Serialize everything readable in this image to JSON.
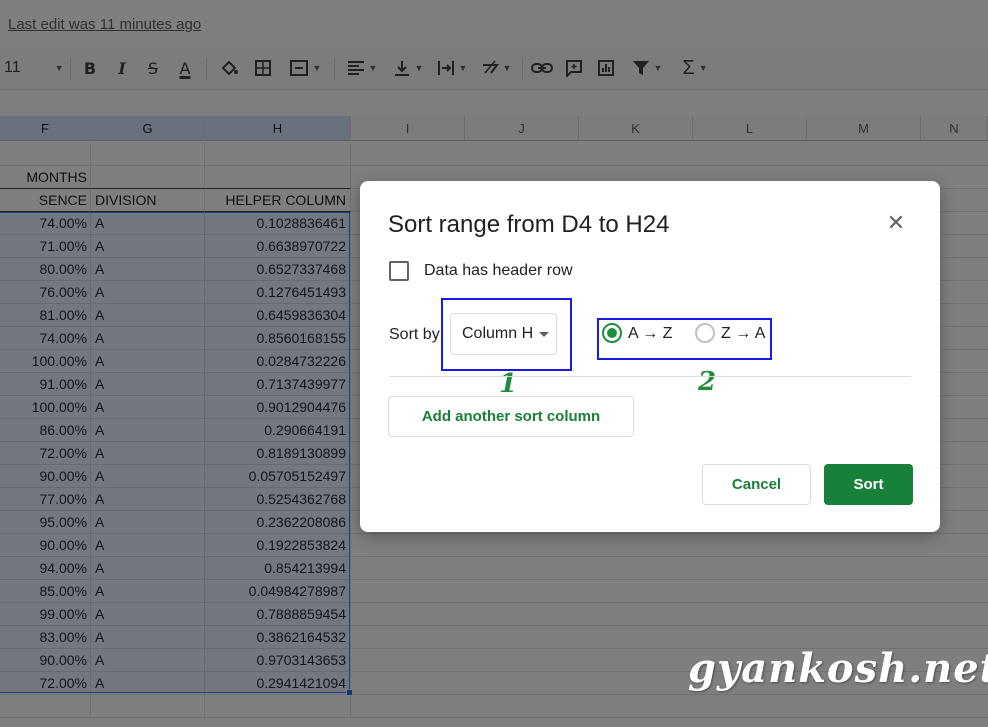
{
  "topbar": {
    "last_edit": "Last edit was 11 minutes ago"
  },
  "toolbar": {
    "font_size": "11",
    "bold": "B",
    "italic": "I",
    "strikethrough": "S",
    "text_color": "A",
    "sigma": "Σ"
  },
  "sheet": {
    "columns": [
      "F",
      "G",
      "H",
      "I",
      "J",
      "K",
      "L",
      "M",
      "N"
    ],
    "header_row1": {
      "f": "MONTHS"
    },
    "header_row2": {
      "f": "SENCE",
      "g": "DIVISION",
      "h": "HELPER COLUMN"
    },
    "rows": [
      {
        "f": "74.00%",
        "g": "A",
        "h": "0.1028836461"
      },
      {
        "f": "71.00%",
        "g": "A",
        "h": "0.6638970722"
      },
      {
        "f": "80.00%",
        "g": "A",
        "h": "0.6527337468"
      },
      {
        "f": "76.00%",
        "g": "A",
        "h": "0.1276451493"
      },
      {
        "f": "81.00%",
        "g": "A",
        "h": "0.6459836304"
      },
      {
        "f": "74.00%",
        "g": "A",
        "h": "0.8560168155"
      },
      {
        "f": "100.00%",
        "g": "A",
        "h": "0.0284732226"
      },
      {
        "f": "91.00%",
        "g": "A",
        "h": "0.7137439977"
      },
      {
        "f": "100.00%",
        "g": "A",
        "h": "0.9012904476"
      },
      {
        "f": "86.00%",
        "g": "A",
        "h": "0.290664191"
      },
      {
        "f": "72.00%",
        "g": "A",
        "h": "0.8189130899"
      },
      {
        "f": "90.00%",
        "g": "A",
        "h": "0.05705152497"
      },
      {
        "f": "77.00%",
        "g": "A",
        "h": "0.5254362768"
      },
      {
        "f": "95.00%",
        "g": "A",
        "h": "0.2362208086"
      },
      {
        "f": "90.00%",
        "g": "A",
        "h": "0.1922853824"
      },
      {
        "f": "94.00%",
        "g": "A",
        "h": "0.854213994"
      },
      {
        "f": "85.00%",
        "g": "A",
        "h": "0.04984278987"
      },
      {
        "f": "99.00%",
        "g": "A",
        "h": "0.7888859454"
      },
      {
        "f": "83.00%",
        "g": "A",
        "h": "0.3862164532"
      },
      {
        "f": "90.00%",
        "g": "A",
        "h": "0.9703143653"
      },
      {
        "f": "72.00%",
        "g": "A",
        "h": "0.2941421094"
      }
    ]
  },
  "dialog": {
    "title": "Sort range from D4 to H24",
    "close_icon": "close-icon",
    "header_checkbox_label": "Data has header row",
    "header_checkbox_checked": false,
    "sort_by_label": "Sort by",
    "sort_column": "Column H",
    "order_az": "A → Z",
    "order_za": "Z → A",
    "selected_order": "A → Z",
    "add_sort_column": "Add another sort column",
    "cancel": "Cancel",
    "sort": "Sort"
  },
  "annotations": {
    "one": "1",
    "two": "2"
  },
  "watermark": "gyankosh.net",
  "colors": {
    "accent_green": "#188038",
    "annotation_blue": "#1a1ae6",
    "selection_blue": "#4285f4"
  }
}
